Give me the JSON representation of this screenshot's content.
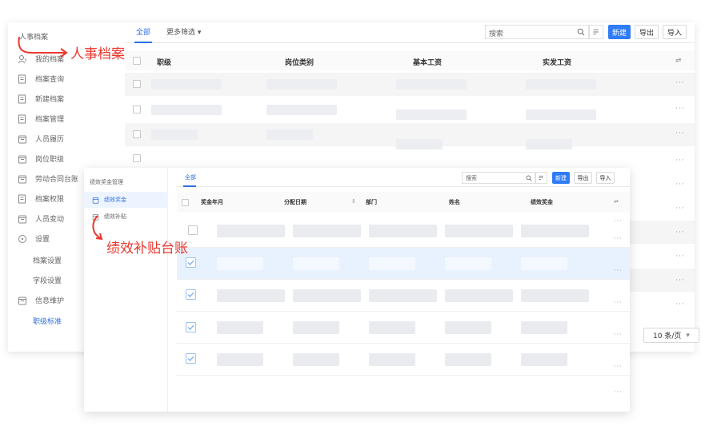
{
  "back": {
    "breadcrumb": "人事档案",
    "sidebar": {
      "items": [
        {
          "label": "我的档案",
          "icon": "person-icon"
        },
        {
          "label": "档案查询",
          "icon": "document-icon"
        },
        {
          "label": "新建档案",
          "icon": "document-icon"
        },
        {
          "label": "档案管理",
          "icon": "document-icon"
        },
        {
          "label": "人员履历",
          "icon": "calendar-icon"
        },
        {
          "label": "岗位职级",
          "icon": "calendar-icon"
        },
        {
          "label": "劳动合同台账",
          "icon": "calendar-icon"
        },
        {
          "label": "档案权限",
          "icon": "document-icon"
        },
        {
          "label": "人员变动",
          "icon": "calendar-icon"
        },
        {
          "label": "设置",
          "icon": "settings-circle-icon"
        },
        {
          "label": "档案设置"
        },
        {
          "label": "字段设置"
        },
        {
          "label": "信息维护",
          "icon": "calendar-icon"
        },
        {
          "label": "职级标准",
          "active": true
        }
      ]
    },
    "tabs": {
      "all": "全部",
      "more": "更多筛选 ▾"
    },
    "search": {
      "placeholder": "搜索"
    },
    "buttons": {
      "new": "新建",
      "export": "导出",
      "import": "导入"
    },
    "table": {
      "headers": [
        "职级",
        "岗位类别",
        "基本工资",
        "实发工资"
      ]
    },
    "row_action": "···",
    "pager": "10 条/页"
  },
  "front": {
    "breadcrumb": "绩效奖金管理",
    "sidebar": {
      "items": [
        {
          "label": "绩效奖金",
          "active": true
        },
        {
          "label": "绩效补贴"
        }
      ]
    },
    "tabs": {
      "all": "全部"
    },
    "search": {
      "placeholder": "搜索"
    },
    "buttons": {
      "new": "新建",
      "export": "导出",
      "import": "导入"
    },
    "table": {
      "headers": [
        "奖金年月",
        "分配日期",
        "部门",
        "姓名",
        "绩效奖金"
      ]
    },
    "sort_icon": "⇕",
    "row_action": "···"
  },
  "annotations": {
    "hr_archive": "人事档案",
    "performance_ledger": "绩效补贴台账"
  },
  "colors": {
    "accent": "#2f7cf6",
    "annotation": "#e8392f"
  }
}
